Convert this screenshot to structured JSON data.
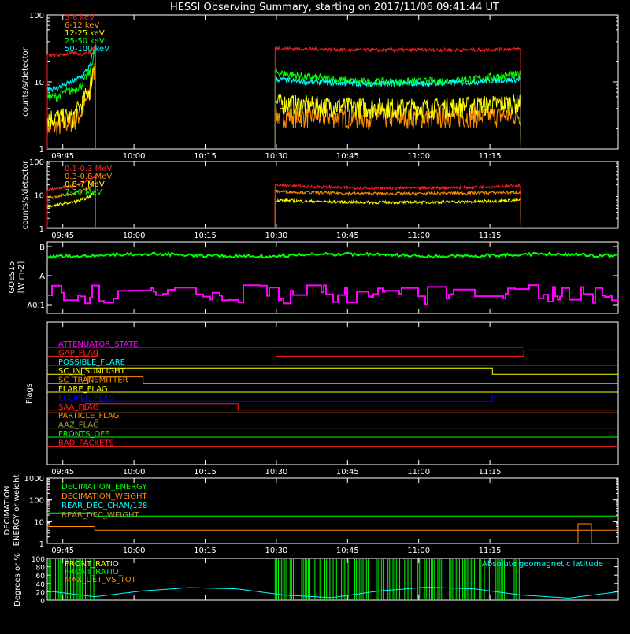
{
  "title": "HESSI Observing Summary, starting on 2017/11/06 09:41:44 UT",
  "colors": {
    "red": "#ff2020",
    "orange": "#ff9000",
    "yellow": "#ffff00",
    "green": "#00ff00",
    "cyan": "#00ffff",
    "magenta": "#ff00ff",
    "blue": "#0000ff",
    "olive": "#a0a040",
    "white": "#ffffff"
  },
  "time_axis": {
    "start": "09:41:44",
    "end": "11:22:00",
    "tick_labels": [
      "09:45",
      "10:00",
      "10:15",
      "10:30",
      "10:45",
      "11:00",
      "11:15"
    ]
  },
  "chart_data": [
    {
      "type": "line",
      "panel": "lightcurves",
      "ylabel": "counts/s/detector",
      "yscale": "log",
      "ylim": [
        1,
        100
      ],
      "ytick_labels": [
        "1",
        "10",
        "100"
      ],
      "x_unit": "minutes",
      "series": [
        {
          "name": "3-6 keV",
          "color": "#ff2020",
          "segments": [
            {
              "x": [
                0,
                2.2,
                3.4,
                5.4,
                7.2,
                9.0,
                10.2
              ],
              "y": [
                25,
                25,
                26,
                27,
                26,
                28,
                35
              ]
            },
            {
              "x": [
                48.0,
                54,
                66,
                78,
                90,
                99.8
              ],
              "y": [
                32,
                31,
                30,
                30,
                30,
                31
              ]
            }
          ]
        },
        {
          "name": "6-12 keV",
          "color": "#ff9000",
          "segments": [
            {
              "x": [
                0,
                2.2,
                3.4,
                5.4,
                7.2,
                9.0,
                10.2
              ],
              "y": [
                2.2,
                2.2,
                2.4,
                2.6,
                3.4,
                6.5,
                18
              ]
            },
            {
              "x": [
                48.0,
                54,
                66,
                78,
                90,
                99.8
              ],
              "y": [
                3.2,
                3.1,
                3.0,
                3.0,
                3.1,
                3.2
              ]
            }
          ]
        },
        {
          "name": "12-25 keV",
          "color": "#ffff00",
          "segments": [
            {
              "x": [
                0,
                2.2,
                3.4,
                5.4,
                7.2,
                9.0,
                10.2
              ],
              "y": [
                3.0,
                3.0,
                3.0,
                3.0,
                4.5,
                8,
                22
              ]
            },
            {
              "x": [
                48.0,
                54,
                66,
                78,
                90,
                99.8
              ],
              "y": [
                5.0,
                4.6,
                4.3,
                4.2,
                4.5,
                5.0
              ]
            }
          ]
        },
        {
          "name": "25-50 keV",
          "color": "#00ff00",
          "segments": [
            {
              "x": [
                0,
                2.2,
                3.4,
                5.4,
                7.2,
                9.0,
                10.2
              ],
              "y": [
                6,
                6,
                7,
                7.5,
                9,
                14,
                30
              ]
            },
            {
              "x": [
                48.0,
                54,
                66,
                78,
                90,
                99.8
              ],
              "y": [
                14,
                12,
                10,
                10,
                11,
                13
              ]
            }
          ]
        },
        {
          "name": "50-100 keV",
          "color": "#00ffff",
          "segments": [
            {
              "x": [
                0,
                2.2,
                3.4,
                5.4,
                7.2,
                9.0,
                10.2
              ],
              "y": [
                8,
                8,
                9,
                10,
                12,
                17,
                37
              ]
            },
            {
              "x": [
                48.0,
                54,
                66,
                78,
                90,
                99.8
              ],
              "y": [
                11,
                10,
                9.5,
                9.5,
                10,
                11
              ]
            }
          ]
        }
      ]
    },
    {
      "type": "line",
      "panel": "high-energy",
      "ylabel": "counts/s/detector",
      "yscale": "log",
      "ylim": [
        1,
        100
      ],
      "ytick_labels": [
        "1",
        "10",
        "100"
      ],
      "x_unit": "minutes",
      "series": [
        {
          "name": "0.1-0.3 MeV",
          "color": "#ff2020",
          "segments": [
            {
              "x": [
                0,
                2.2,
                3.4,
                5.4,
                7.2,
                9.0,
                10.2
              ],
              "y": [
                14,
                15,
                17,
                18,
                22,
                28,
                38
              ]
            },
            {
              "x": [
                48.0,
                54,
                66,
                78,
                90,
                99.8
              ],
              "y": [
                20,
                18,
                16,
                16,
                17,
                19
              ]
            }
          ]
        },
        {
          "name": "0.3-0.8 MeV",
          "color": "#ff9000",
          "segments": [
            {
              "x": [
                0,
                2.2,
                3.4,
                5.4,
                7.2,
                9.0,
                10.2
              ],
              "y": [
                8,
                9,
                10,
                11,
                13,
                17,
                24
              ]
            },
            {
              "x": [
                48.0,
                54,
                66,
                78,
                90,
                99.8
              ],
              "y": [
                13,
                12,
                11,
                11,
                11.5,
                12
              ]
            }
          ]
        },
        {
          "name": "0.8-7 MeV",
          "color": "#ffff00",
          "segments": [
            {
              "x": [
                0,
                2.2,
                3.4,
                5.4,
                7.2,
                9.0,
                10.2
              ],
              "y": [
                4.5,
                5,
                5.5,
                6,
                7,
                9,
                13
              ]
            },
            {
              "x": [
                48.0,
                54,
                66,
                78,
                90,
                99.8
              ],
              "y": [
                7,
                6.5,
                6,
                6,
                6.3,
                7
              ]
            }
          ]
        },
        {
          "name": "7-20 MeV",
          "color": "#00ff00",
          "segments": []
        }
      ]
    },
    {
      "type": "line",
      "panel": "goes",
      "ylabel": "GOES15",
      "ylabel2": "[W m-2]",
      "ytick_labels": [
        "A0.1",
        "A",
        "B"
      ],
      "series": [
        {
          "name": "GOES long channel",
          "color": "#00ff00",
          "level": 0.82
        },
        {
          "name": "GOES short channel",
          "color": "#ff00ff",
          "level": 0.18
        }
      ]
    },
    {
      "type": "line",
      "panel": "flags",
      "ylabel": "Flags",
      "series": [
        {
          "name": "ATTENUATOR_STATE",
          "color": "#ff00ff",
          "segments": [
            {
              "x0": 0,
              "x1": 100.3,
              "on": false
            }
          ]
        },
        {
          "name": "GAP_FLAG",
          "color": "#ff2020",
          "segments": [
            {
              "x0": 0,
              "x1": 10.5,
              "on": false
            },
            {
              "x0": 10.5,
              "x1": 48.2,
              "on": true
            },
            {
              "x0": 48.2,
              "x1": 100.4,
              "on": false
            },
            {
              "x0": 100.4,
              "x1": 120.3,
              "on": true
            }
          ]
        },
        {
          "name": "POSSIBLE_FLARE",
          "color": "#00ffff",
          "segments": [
            {
              "x0": 0,
              "x1": 120.3,
              "on": false
            }
          ]
        },
        {
          "name": "SC_IN_SUNLIGHT",
          "color": "#ffff00",
          "segments": [
            {
              "x0": 0,
              "x1": 7.2,
              "on": false
            },
            {
              "x0": 7.2,
              "x1": 93.8,
              "on": true
            },
            {
              "x0": 93.8,
              "x1": 120.3,
              "on": false
            }
          ]
        },
        {
          "name": "SC_TRANSMITTER",
          "color": "#ff9000",
          "segments": [
            {
              "x0": 0,
              "x1": 8.6,
              "on": false
            },
            {
              "x0": 8.6,
              "x1": 20.2,
              "on": true
            },
            {
              "x0": 20.2,
              "x1": 120.3,
              "on": false
            }
          ]
        },
        {
          "name": "FLARE_FLAG",
          "color": "#ffff00",
          "segments": [
            {
              "x0": 0,
              "x1": 120.3,
              "on": false
            }
          ]
        },
        {
          "name": "ECLIPSE_FLAG",
          "color": "#0000ff",
          "segments": [
            {
              "x0": 0,
              "x1": 7.2,
              "on": true
            },
            {
              "x0": 7.2,
              "x1": 93.8,
              "on": false
            },
            {
              "x0": 93.8,
              "x1": 120.3,
              "on": true
            }
          ]
        },
        {
          "name": "SAA_FLAG",
          "color": "#ff2020",
          "segments": [
            {
              "x0": 0,
              "x1": 8.0,
              "on": false
            },
            {
              "x0": 8.0,
              "x1": 40.2,
              "on": true
            },
            {
              "x0": 40.2,
              "x1": 120.3,
              "on": false
            }
          ]
        },
        {
          "name": "PARTICLE_FLAG",
          "color": "#ff9000",
          "segments": [
            {
              "x0": 0,
              "x1": 120.3,
              "on": true
            }
          ]
        },
        {
          "name": "AAZ_FLAG",
          "color": "#a0a040",
          "segments": [
            {
              "x0": 0,
              "x1": 120.3,
              "on": false
            }
          ]
        },
        {
          "name": "FRONTS_OFF",
          "color": "#00ff00",
          "segments": [
            {
              "x0": 0,
              "x1": 120.3,
              "on": false
            }
          ]
        },
        {
          "name": "BAD_PACKETS",
          "color": "#ff2020",
          "segments": [
            {
              "x0": 0,
              "x1": 120.3,
              "on": false
            }
          ]
        }
      ]
    },
    {
      "type": "line",
      "panel": "decimation",
      "ylabel": "DECIMATION",
      "ylabel2": "ENERGY or weight",
      "yscale": "log",
      "ylim": [
        1,
        1000
      ],
      "ytick_labels": [
        "1",
        "10",
        "100",
        "1000"
      ],
      "series": [
        {
          "name": "DECIMATION_ENERGY",
          "color": "#00ff00",
          "segments": [
            {
              "x": [
                0,
                10.0,
                10.0,
                120.3
              ],
              "y": [
                25,
                25,
                18,
                18
              ]
            }
          ]
        },
        {
          "name": "DECIMATION_WEIGHT",
          "color": "#ff9000",
          "segments": [
            {
              "x": [
                0,
                10.0,
                10.0,
                120.3
              ],
              "y": [
                6,
                6,
                4,
                4
              ]
            }
          ]
        },
        {
          "name": "REAR_DEC_CHAN/128",
          "color": "#00ffff",
          "segments": []
        },
        {
          "name": "REAR_DEC_WEIGHT",
          "color": "#a0a040",
          "segments": []
        }
      ]
    },
    {
      "type": "line",
      "panel": "ratios",
      "ylabel": "Degrees or %",
      "ylim": [
        0,
        100
      ],
      "ytick_labels": [
        "0",
        "20",
        "40",
        "60",
        "80",
        "100"
      ],
      "annotation": "Absolute geomagnetic latitude",
      "series": [
        {
          "name": "FRONT_RATIO",
          "color": "#ffff00"
        },
        {
          "name": "FRONT_RATIO_",
          "color": "#00ff00",
          "segments": [
            {
              "x0": 0,
              "x1": 10.3
            },
            {
              "x0": 48.0,
              "x1": 99.8
            }
          ]
        },
        {
          "name": "MAX_DET_VS_TOT",
          "color": "#ff9000"
        },
        {
          "name": "Absolute geomagnetic latitude",
          "color": "#00ffff",
          "x": [
            0,
            10,
            20,
            30,
            40,
            50,
            60,
            70,
            80,
            90,
            100,
            110,
            120.3
          ],
          "y": [
            22,
            8,
            22,
            30,
            27,
            12,
            6,
            22,
            31,
            27,
            12,
            5,
            20
          ]
        }
      ]
    }
  ]
}
